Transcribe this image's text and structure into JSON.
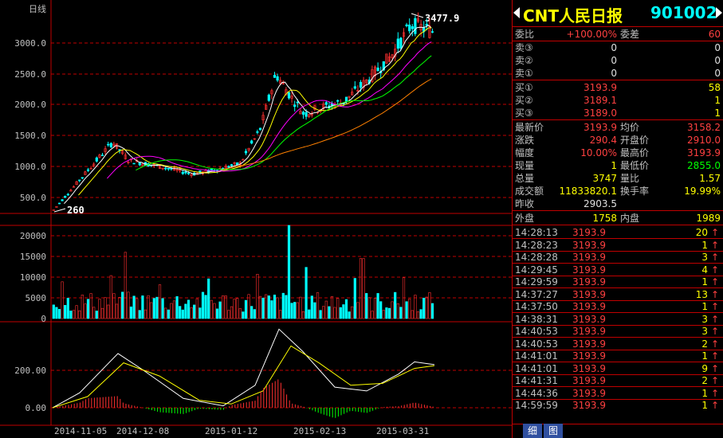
{
  "left": {
    "period_label": "日线",
    "high_marker": "3477.9",
    "low_marker": "260",
    "price_axis": [
      "3000.0",
      "2500.0",
      "2000.0",
      "1500.0",
      "1000.0",
      "500.0"
    ],
    "vol_axis": [
      "20000",
      "15000",
      "10000",
      "5000",
      "0"
    ],
    "macd_axis": [
      "200.00",
      "0.00"
    ],
    "dates": [
      "2014-11-05",
      "2014-12-08",
      "2015-01-12",
      "2015-02-13",
      "2015-03-31"
    ]
  },
  "panel": {
    "name": "CNT人民日报",
    "code": "901002",
    "quote": {
      "weibi_label": "委比",
      "weibi": "+100.00%",
      "weicha_label": "委差",
      "weicha": "60",
      "sell3_label": "卖③",
      "sell3_price": "0",
      "sell3_vol": "0",
      "sell2_label": "卖②",
      "sell2_price": "0",
      "sell2_vol": "0",
      "sell1_label": "卖①",
      "sell1_price": "0",
      "sell1_vol": "0",
      "buy1_label": "买①",
      "buy1_price": "3193.9",
      "buy1_vol": "58",
      "buy2_label": "买②",
      "buy2_price": "3189.1",
      "buy2_vol": "1",
      "buy3_label": "买③",
      "buy3_price": "3189.0",
      "buy3_vol": "1",
      "last_label": "最新价",
      "last": "3193.9",
      "avg_label": "均价",
      "avg": "3158.2",
      "chg_label": "涨跌",
      "chg": "290.4",
      "open_label": "开盘价",
      "open": "2910.0",
      "pct_label": "幅度",
      "pct": "10.00%",
      "high_label": "最高价",
      "high": "3193.9",
      "cur_label": "现量",
      "cur": "1",
      "low_label": "最低价",
      "low": "2855.0",
      "total_label": "总量",
      "total": "3747",
      "ratio_label": "量比",
      "ratio": "1.57",
      "amount_label": "成交额",
      "amount": "11833820.1",
      "turnover_label": "换手率",
      "turnover": "19.99%",
      "prev_label": "昨收",
      "prev": "2903.5",
      "outer_label": "外盘",
      "outer": "1758",
      "inner_label": "内盘",
      "inner": "1989"
    },
    "ticks": [
      {
        "time": "14:28:13",
        "price": "3193.9",
        "vol": "20",
        "arrow": "↑"
      },
      {
        "time": "14:28:23",
        "price": "3193.9",
        "vol": "1",
        "arrow": "↑"
      },
      {
        "time": "14:28:28",
        "price": "3193.9",
        "vol": "3",
        "arrow": "↑"
      },
      {
        "time": "14:29:45",
        "price": "3193.9",
        "vol": "4",
        "arrow": "↑"
      },
      {
        "time": "14:29:59",
        "price": "3193.9",
        "vol": "1",
        "arrow": "↑"
      },
      {
        "time": "14:37:27",
        "price": "3193.9",
        "vol": "13",
        "arrow": "↑"
      },
      {
        "time": "14:37:50",
        "price": "3193.9",
        "vol": "1",
        "arrow": "↑"
      },
      {
        "time": "14:38:31",
        "price": "3193.9",
        "vol": "3",
        "arrow": "↑"
      },
      {
        "time": "14:40:53",
        "price": "3193.9",
        "vol": "3",
        "arrow": "↑"
      },
      {
        "time": "14:40:53",
        "price": "3193.9",
        "vol": "2",
        "arrow": "↑"
      },
      {
        "time": "14:41:01",
        "price": "3193.9",
        "vol": "1",
        "arrow": "↑"
      },
      {
        "time": "14:41:01",
        "price": "3193.9",
        "vol": "9",
        "arrow": "↑"
      },
      {
        "time": "14:41:31",
        "price": "3193.9",
        "vol": "2",
        "arrow": "↑"
      },
      {
        "time": "14:44:36",
        "price": "3193.9",
        "vol": "1",
        "arrow": "↑"
      },
      {
        "time": "14:59:59",
        "price": "3193.9",
        "vol": "1",
        "arrow": "↑"
      }
    ],
    "tabs": [
      "细",
      "图"
    ]
  },
  "colors": {
    "up": "#ff3030",
    "down": "#00ffff",
    "grid": "#c00000",
    "ma5": "#ffffff",
    "ma10": "#ffff00",
    "ma20": "#ff00ff",
    "ma30": "#00ff00",
    "ma60": "#ff8000"
  }
}
